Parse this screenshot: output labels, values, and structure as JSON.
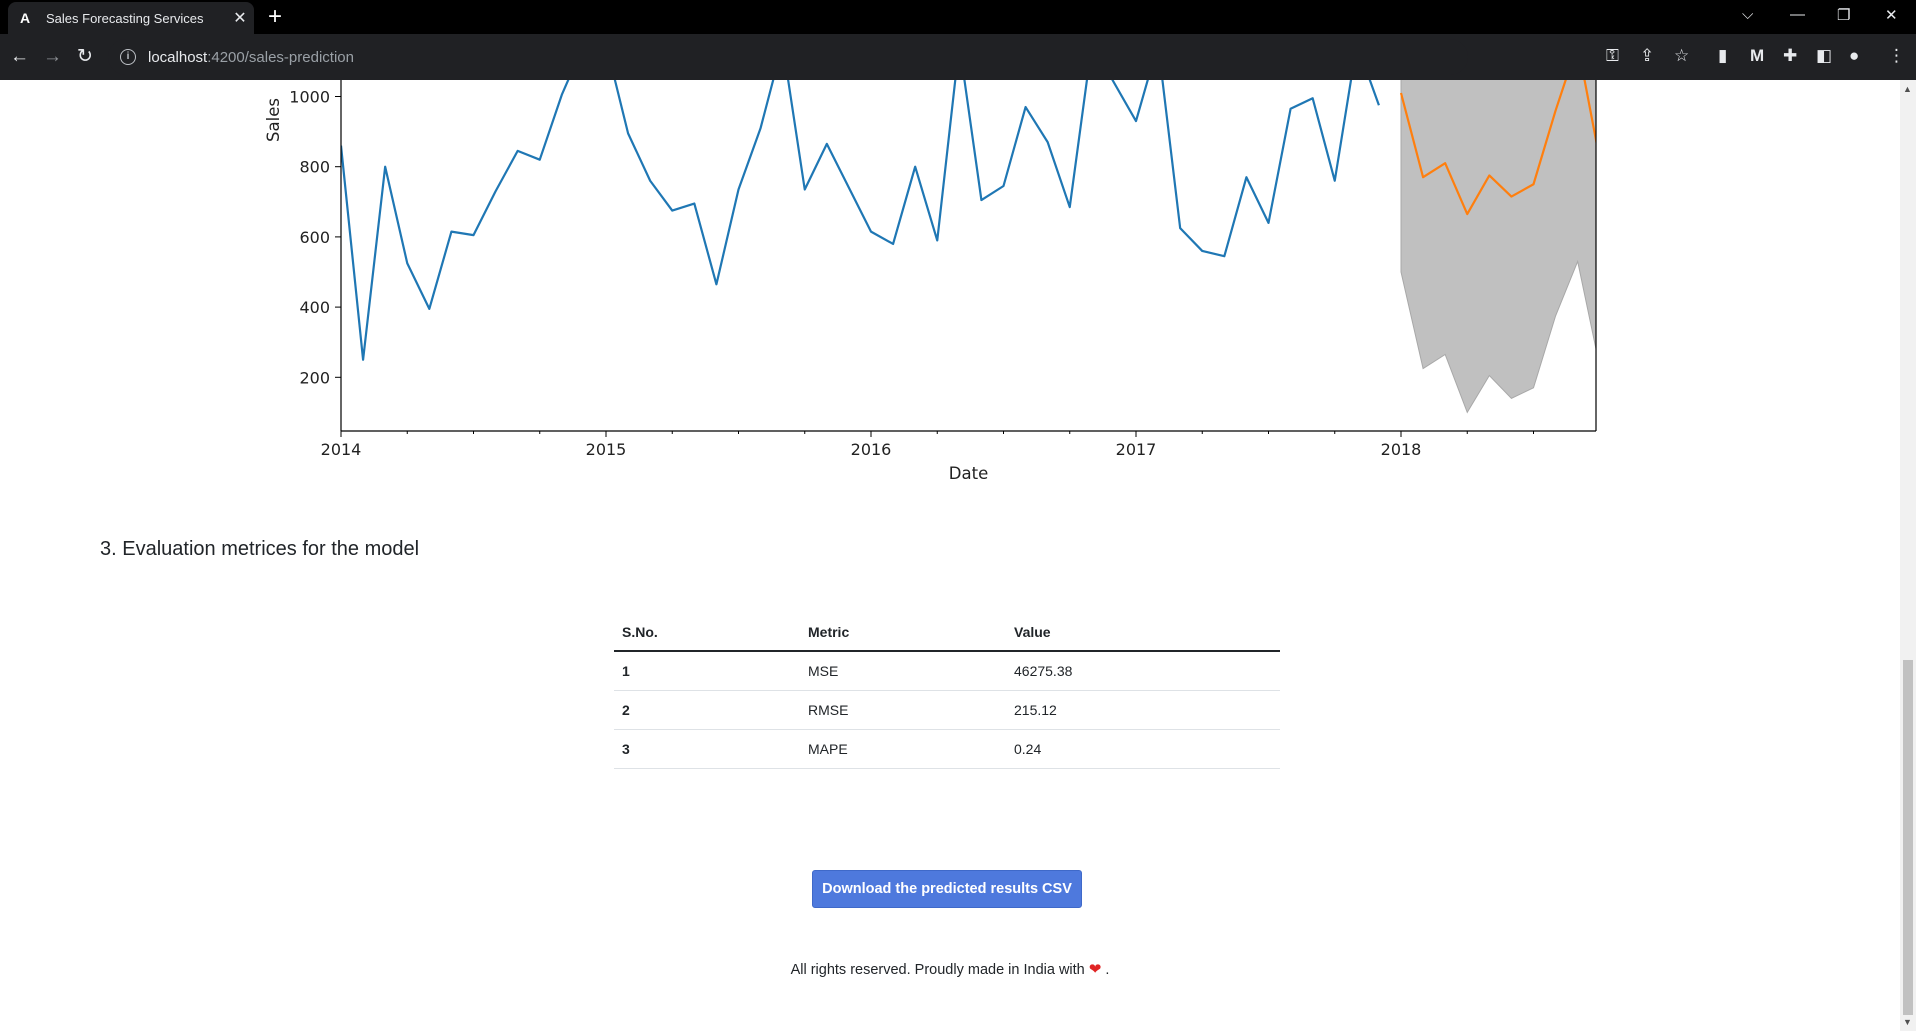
{
  "browser": {
    "tab_title": "Sales Forecasting Services",
    "tab_favicon": "A",
    "url_host": "localhost",
    "url_path": ":4200/sales-prediction"
  },
  "chart_data": {
    "type": "line",
    "xlabel": "Date",
    "ylabel": "Sales",
    "x_ticks": [
      "2014",
      "2015",
      "2016",
      "2017",
      "2018"
    ],
    "y_ticks": [
      200,
      400,
      600,
      800,
      1000
    ],
    "xlim": [
      "2014-01",
      "2018-09"
    ],
    "ylim_visible": [
      20,
      1000
    ],
    "series": [
      {
        "color": "#1f77b4",
        "points": [
          [
            "2014-01",
            860
          ],
          [
            "2014-02",
            250
          ],
          [
            "2014-03",
            800
          ],
          [
            "2014-04",
            525
          ],
          [
            "2014-05",
            395
          ],
          [
            "2014-06",
            615
          ],
          [
            "2014-07",
            605
          ],
          [
            "2014-08",
            730
          ],
          [
            "2014-09",
            845
          ],
          [
            "2014-10",
            820
          ],
          [
            "2014-11",
            1005
          ],
          [
            "2014-12",
            1150
          ],
          [
            "2015-01",
            1150
          ],
          [
            "2015-02",
            895
          ],
          [
            "2015-03",
            760
          ],
          [
            "2015-04",
            675
          ],
          [
            "2015-05",
            695
          ],
          [
            "2015-06",
            465
          ],
          [
            "2015-07",
            735
          ],
          [
            "2015-08",
            910
          ],
          [
            "2015-09",
            1150
          ],
          [
            "2015-10",
            735
          ],
          [
            "2015-11",
            865
          ],
          [
            "2015-12",
            740
          ],
          [
            "2016-01",
            615
          ],
          [
            "2016-02",
            580
          ],
          [
            "2016-03",
            800
          ],
          [
            "2016-04",
            590
          ],
          [
            "2016-05",
            1150
          ],
          [
            "2016-06",
            705
          ],
          [
            "2016-07",
            745
          ],
          [
            "2016-08",
            970
          ],
          [
            "2016-09",
            870
          ],
          [
            "2016-10",
            685
          ],
          [
            "2016-11",
            1150
          ],
          [
            "2017-01",
            930
          ],
          [
            "2017-02",
            1150
          ],
          [
            "2017-03",
            625
          ],
          [
            "2017-04",
            560
          ],
          [
            "2017-05",
            545
          ],
          [
            "2017-06",
            770
          ],
          [
            "2017-07",
            640
          ],
          [
            "2017-08",
            965
          ],
          [
            "2017-09",
            995
          ],
          [
            "2017-10",
            760
          ],
          [
            "2017-11",
            1150
          ],
          [
            "2017-12",
            975
          ]
        ]
      },
      {
        "color": "#ff7f0e",
        "points": [
          [
            "2018-01",
            1010
          ],
          [
            "2018-02",
            770
          ],
          [
            "2018-03",
            810
          ],
          [
            "2018-04",
            665
          ],
          [
            "2018-05",
            775
          ],
          [
            "2018-06",
            715
          ],
          [
            "2018-07",
            750
          ],
          [
            "2018-08",
            960
          ],
          [
            "2018-09",
            1150
          ],
          [
            "2018-10",
            820
          ]
        ]
      }
    ],
    "confidence_band": {
      "color": "#c0c0c0",
      "x": [
        "2018-01",
        "2018-02",
        "2018-03",
        "2018-04",
        "2018-05",
        "2018-06",
        "2018-07",
        "2018-08",
        "2018-09",
        "2018-10"
      ],
      "lower": [
        500,
        225,
        265,
        100,
        205,
        140,
        170,
        375,
        530,
        230
      ],
      "upper": [
        1150,
        1150,
        1150,
        1150,
        1150,
        1150,
        1150,
        1150,
        1150,
        1150
      ]
    }
  },
  "section": {
    "title": "3. Evaluation metrices for the model"
  },
  "metrics_table": {
    "headers": [
      "S.No.",
      "Metric",
      "Value"
    ],
    "rows": [
      [
        "1",
        "MSE",
        "46275.38"
      ],
      [
        "2",
        "RMSE",
        "215.12"
      ],
      [
        "3",
        "MAPE",
        "0.24"
      ]
    ]
  },
  "download_button": "Download the predicted results CSV",
  "footer": {
    "text": "All rights reserved. Proudly made in India with",
    "end": "."
  }
}
